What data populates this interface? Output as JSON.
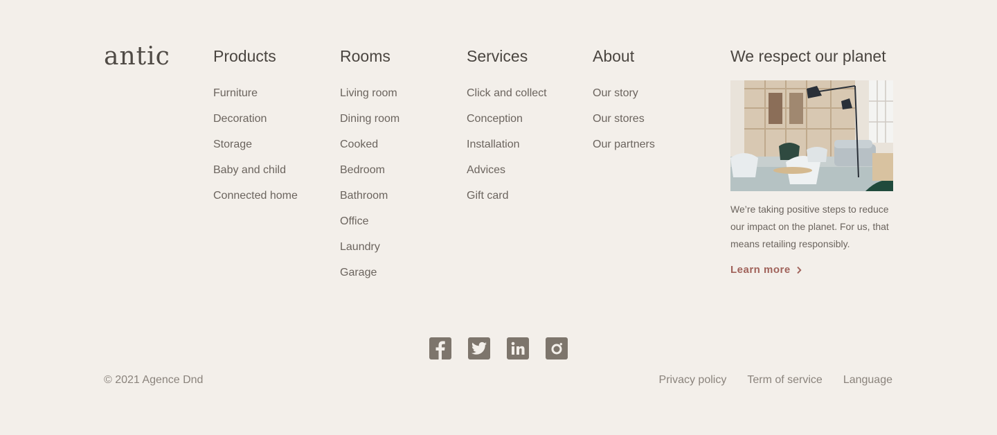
{
  "brand": {
    "logo": "antic"
  },
  "columns": {
    "products": {
      "title": "Products",
      "items": [
        "Furniture",
        "Decoration",
        "Storage",
        "Baby and child",
        "Connected home"
      ]
    },
    "rooms": {
      "title": "Rooms",
      "items": [
        "Living room",
        "Dining room",
        "Cooked",
        "Bedroom",
        "Bathroom",
        "Office",
        "Laundry",
        "Garage"
      ]
    },
    "services": {
      "title": "Services",
      "items": [
        "Click and collect",
        "Conception",
        "Installation",
        "Advices",
        "Gift card"
      ]
    },
    "about": {
      "title": "About",
      "items": [
        "Our story",
        "Our stores",
        "Our partners"
      ]
    }
  },
  "planet": {
    "title": "We respect our planet",
    "text": "We’re taking positive steps to reduce our impact on the planet. For us, that means retailing responsibly.",
    "link": "Learn more"
  },
  "social": {
    "icons": [
      "facebook-icon",
      "twitter-icon",
      "linkedin-icon",
      "instagram-icon"
    ]
  },
  "footer": {
    "copyright": "© 2021 Agence Dnd",
    "links": [
      "Privacy policy",
      "Term of service",
      "Language"
    ]
  },
  "colors": {
    "background": "#f3efea",
    "accent": "#a0625a",
    "icon": "#7d756c",
    "text": "#6b645e"
  }
}
